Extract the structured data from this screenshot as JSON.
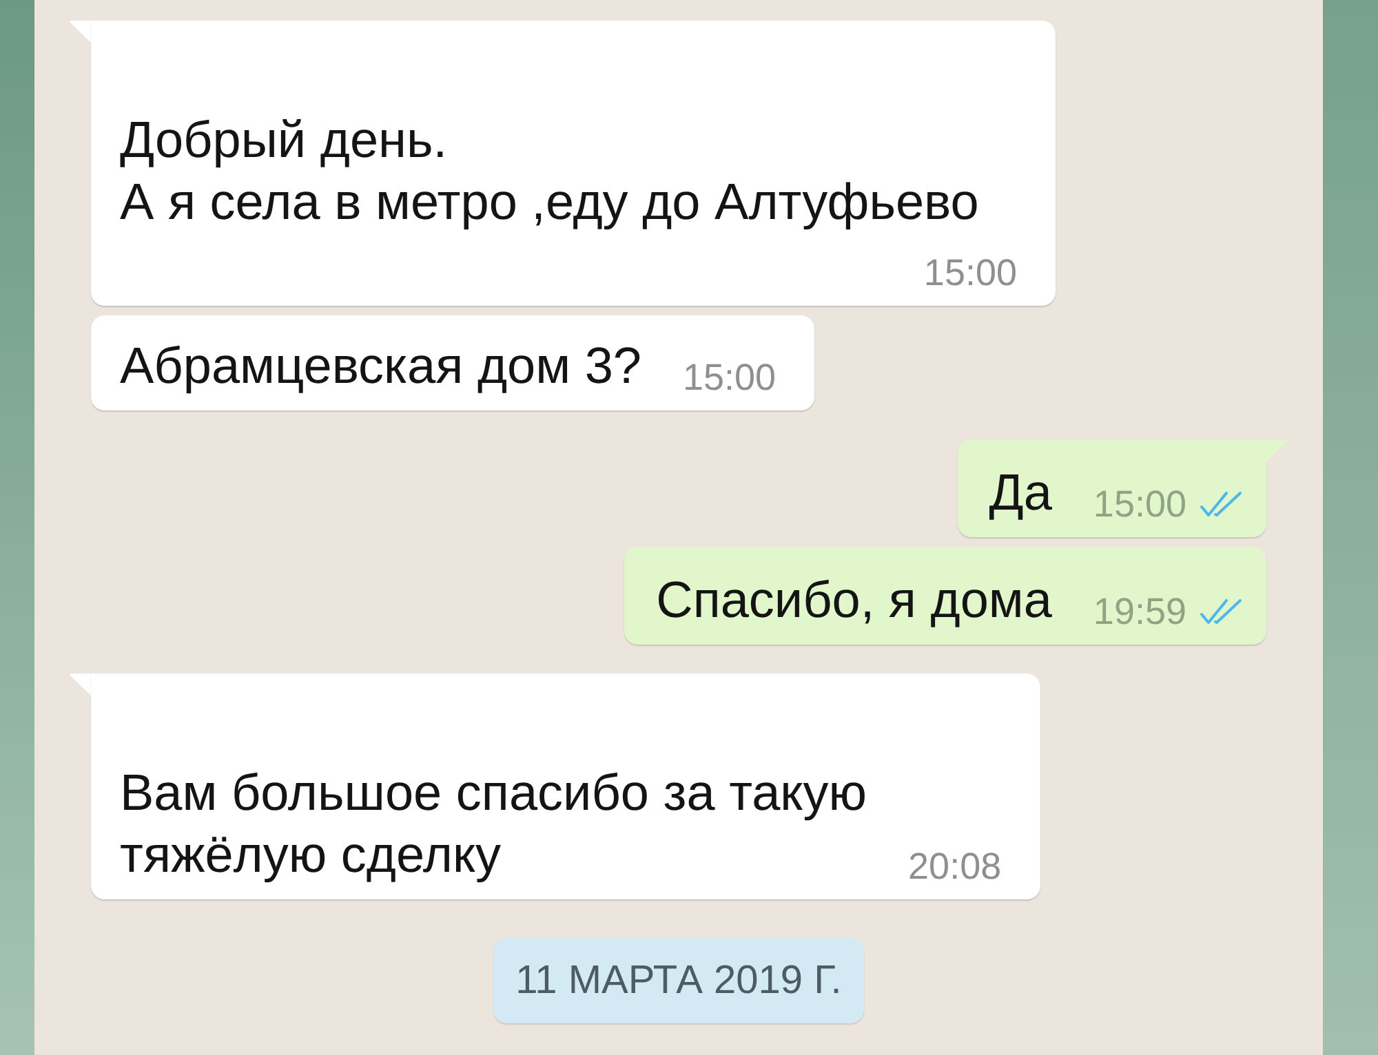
{
  "messages": [
    {
      "kind": "incoming",
      "tail": true,
      "text": "Добрый день.\nА я села в метро ,еду до Алтуфьево",
      "time": "15:00"
    },
    {
      "kind": "incoming",
      "tail": false,
      "text": "Абрамцевская дом 3?",
      "time": "15:00"
    },
    {
      "kind": "outgoing",
      "tail": true,
      "text": "Да",
      "time": "15:00",
      "read": true
    },
    {
      "kind": "outgoing",
      "tail": false,
      "text": "Спасибо, я дома",
      "time": "19:59",
      "read": true
    },
    {
      "kind": "incoming",
      "tail": true,
      "text": "Вам большое спасибо за такую\nтяжёлую сделку",
      "time": "20:08"
    }
  ],
  "date_divider": {
    "text": "11 МАРТА 2019 Г."
  }
}
